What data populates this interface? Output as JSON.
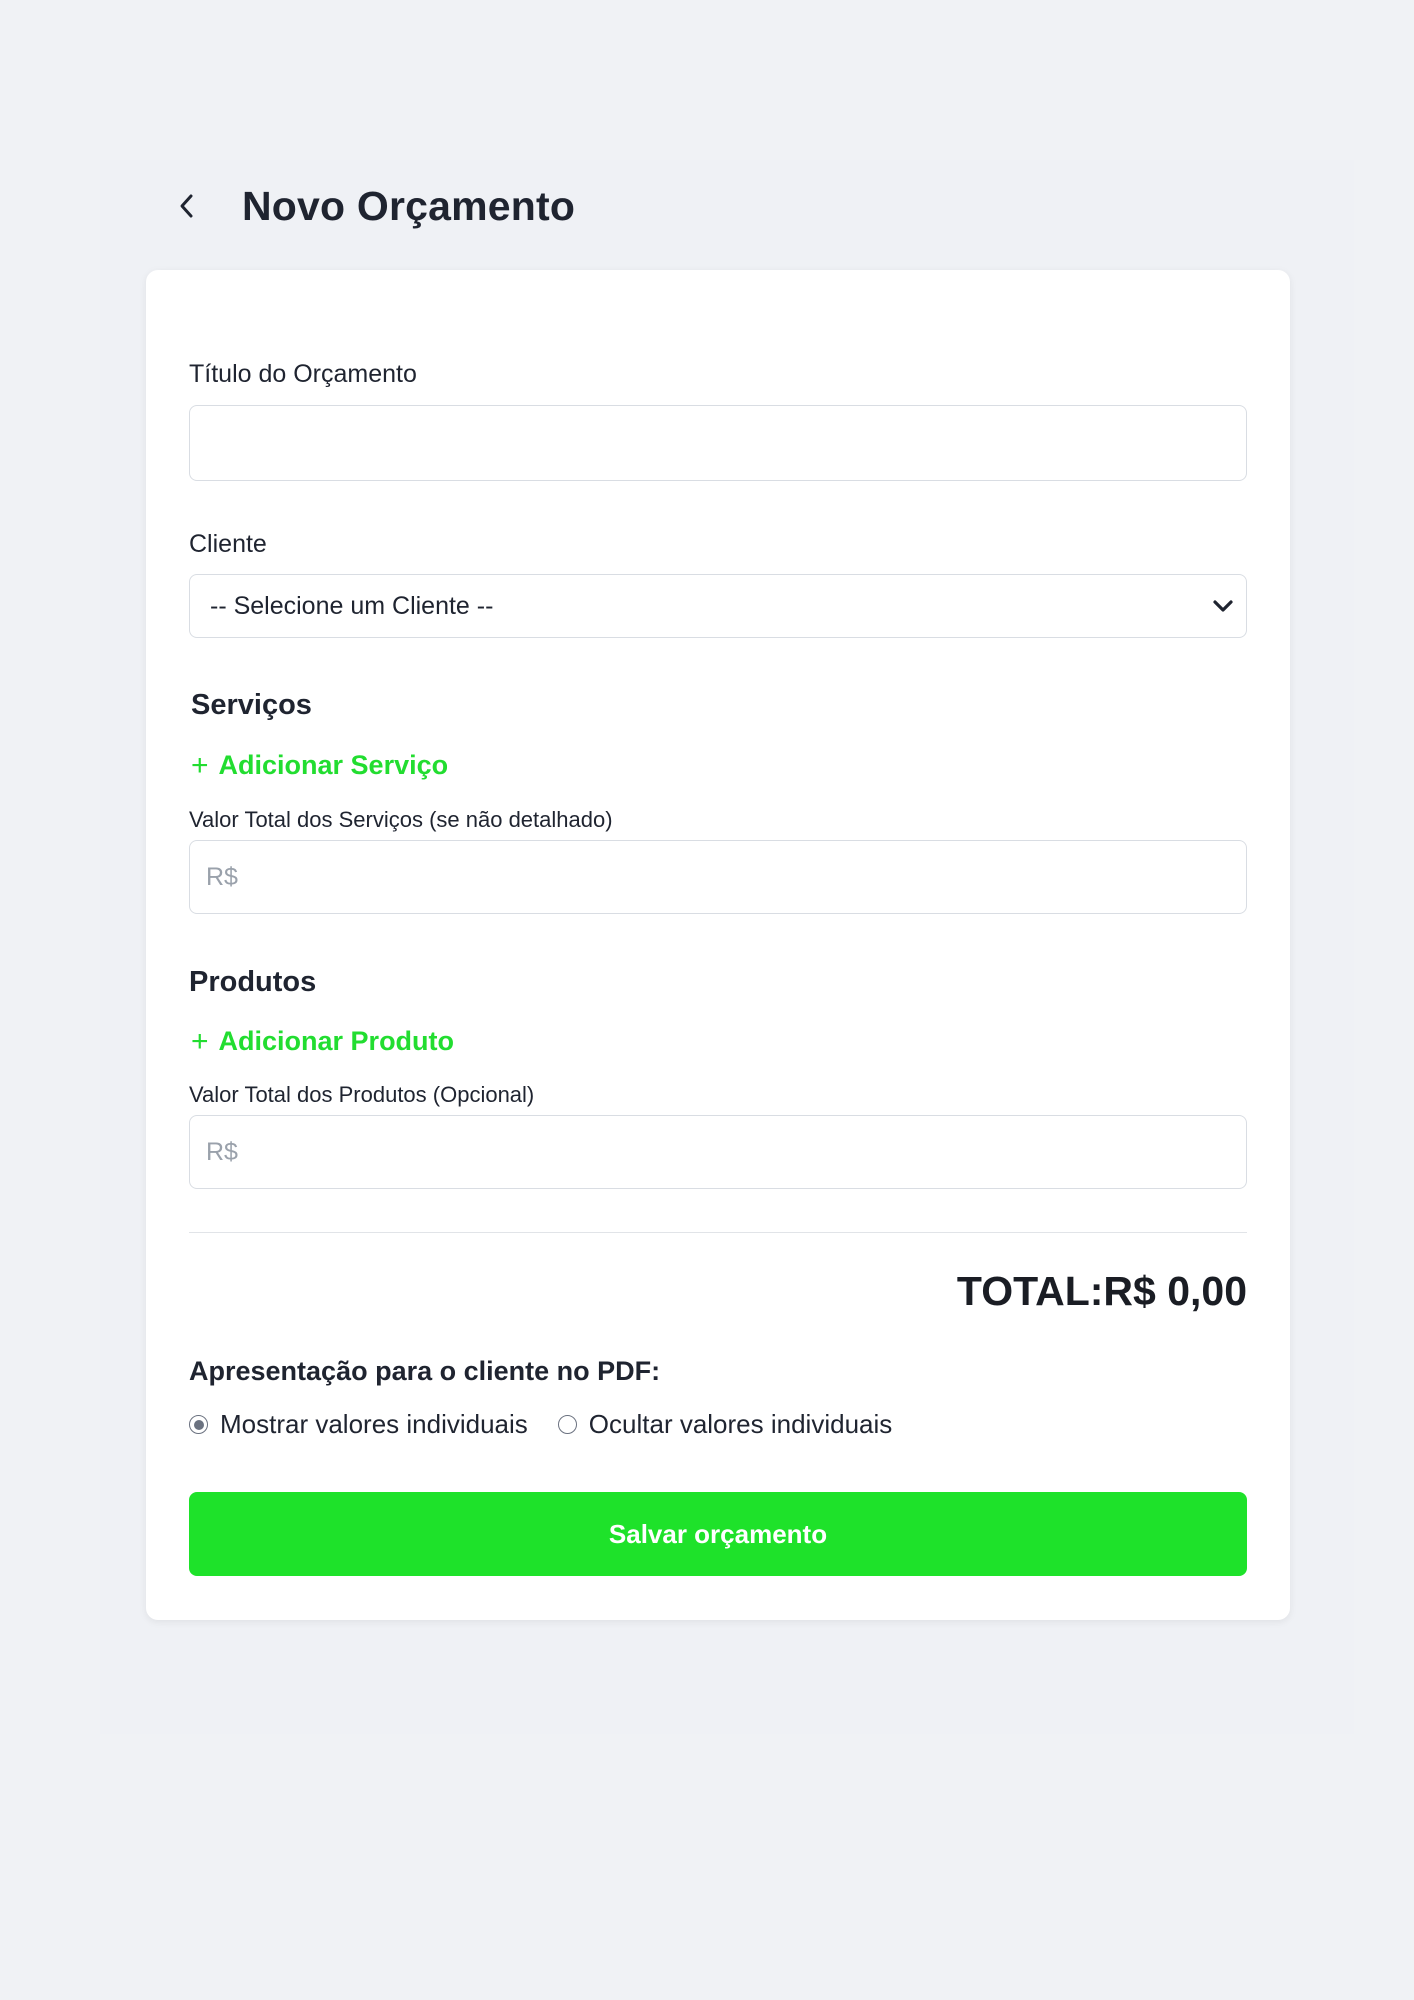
{
  "header": {
    "title": "Novo Orçamento",
    "back_icon": "chevron-left-icon"
  },
  "form": {
    "title_label": "Título do Orçamento",
    "title_value": "",
    "client_label": "Cliente",
    "client_selected": "-- Selecione um Cliente --",
    "services": {
      "heading": "Serviços",
      "add_label": "Adicionar Serviço",
      "total_label": "Valor Total dos Serviços (se não detalhado)",
      "total_placeholder": "R$"
    },
    "products": {
      "heading": "Produtos",
      "add_label": "Adicionar Produto",
      "total_label": "Valor Total dos Produtos (Opcional)",
      "total_placeholder": "R$"
    },
    "total_text": "TOTAL:R$ 0,00",
    "pdf": {
      "heading": "Apresentação para o cliente no PDF:",
      "options": [
        {
          "label": "Mostrar valores individuais",
          "selected": true
        },
        {
          "label": "Ocultar valores individuais",
          "selected": false
        }
      ]
    },
    "save_label": "Salvar orçamento"
  },
  "colors": {
    "accent": "#22dd30",
    "button": "#1ee22a",
    "background": "#f0f2f5"
  }
}
